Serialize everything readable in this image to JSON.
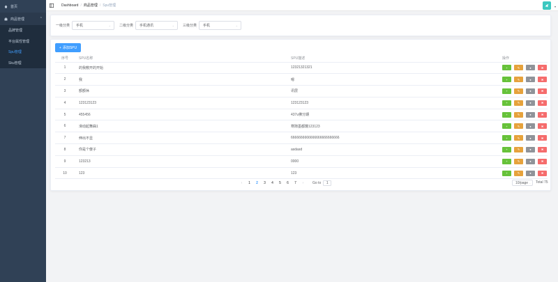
{
  "sidebar": {
    "home": "首页",
    "group": "商品管理",
    "items": [
      {
        "label": "品牌管理",
        "active": false
      },
      {
        "label": "平台属性管理",
        "active": false
      },
      {
        "label": "Spu管理",
        "active": true
      },
      {
        "label": "Sku管理",
        "active": false
      }
    ]
  },
  "header": {
    "breadcrumb": [
      "Dashboard",
      "商品管理",
      "Spu管理"
    ]
  },
  "filter": {
    "level1_label": "一级分类",
    "level1_value": "手机",
    "level2_label": "二级分类",
    "level2_value": "手机通讯",
    "level3_label": "三级分类",
    "level3_value": "手机"
  },
  "main": {
    "add_button": "添加SPU",
    "columns": [
      "序号",
      "SPU名称",
      "SPU描述",
      "操作"
    ],
    "rows": [
      {
        "index": "1",
        "name": "的我敷开的开始",
        "desc": "12321321321"
      },
      {
        "index": "2",
        "name": "我",
        "desc": "嗯"
      },
      {
        "index": "3",
        "name": "额额休",
        "desc": "讯层"
      },
      {
        "index": "4",
        "name": "123123123",
        "desc": "123123123"
      },
      {
        "index": "5",
        "name": "455456",
        "desc": "437u佛分期"
      },
      {
        "index": "6",
        "name": "滑动起舞曲1",
        "desc": "寒隙墨都蔑123123"
      },
      {
        "index": "7",
        "name": "伸出不显",
        "desc": "6666666666666666666666666"
      },
      {
        "index": "8",
        "name": "你是个傻子",
        "desc": "asdasd"
      },
      {
        "index": "9",
        "name": "123213",
        "desc": "0000"
      },
      {
        "index": "10",
        "name": "123",
        "desc": "123"
      }
    ],
    "op_icons": [
      "plus-icon",
      "edit-icon",
      "info-icon",
      "delete-icon"
    ]
  },
  "pagination": {
    "prev": "‹",
    "pages": [
      "1",
      "2",
      "3",
      "4",
      "5",
      "6",
      "7"
    ],
    "current": "2",
    "next": "›",
    "goto_label": "Go to",
    "goto_value": "1",
    "page_size": "10/page",
    "total": "Total 75"
  },
  "colors": {
    "sidebar_bg": "#304156",
    "primary": "#409eff",
    "success": "#67c23a",
    "warning": "#e6a23c",
    "info": "#909399",
    "danger": "#f56c6c"
  }
}
